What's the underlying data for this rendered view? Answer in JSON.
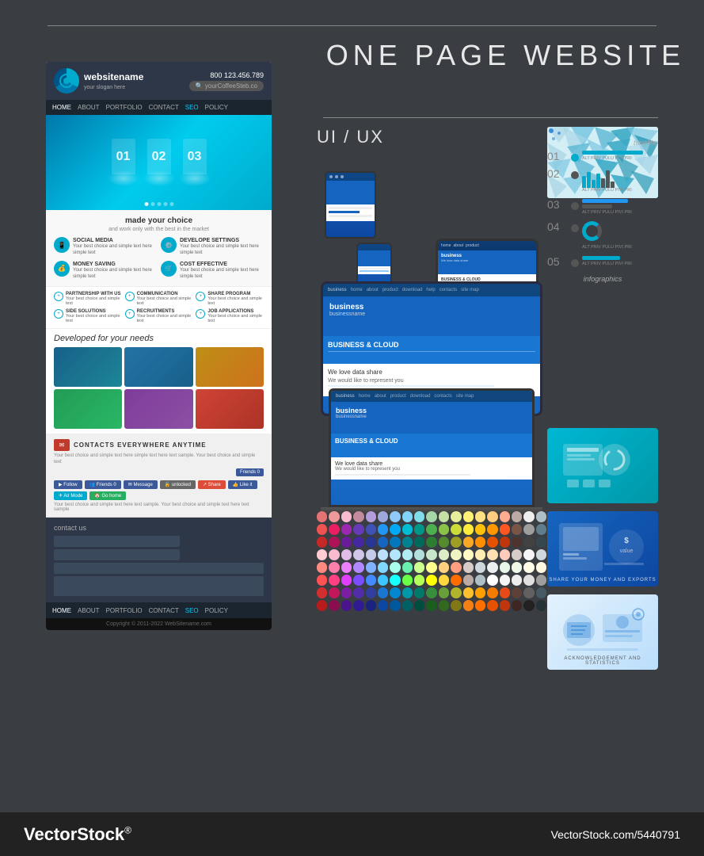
{
  "title": "ONE PAGE WEBSITE",
  "watermark": {
    "left": "VectorStock",
    "registered": "®",
    "right": "VectorStock.com/5440791"
  },
  "website_mockup": {
    "logo_name": "websitename",
    "logo_slogan": "your slogan here",
    "phone": "800 123.456.789",
    "email": "yourCoffeeSteb.co",
    "nav_items": [
      "HOME",
      "ABOUT",
      "PORTFOLIO",
      "CONTACT",
      "SEO",
      "POLICY"
    ],
    "hero_numbers": [
      "01",
      "02",
      "03"
    ],
    "section_title": "made your choice",
    "section_subtitle": "and work only with the best in the market",
    "features": [
      {
        "title": "SOCIAL MEDIA",
        "text": "Your best choice and simple text here simple text here text simple"
      },
      {
        "title": "DEVELOPE SETTINGS",
        "text": "Your best choice and simple text here simple text here text simple"
      },
      {
        "title": "MONEY SAVING",
        "text": "Your best choice and simple text here simple text here text simple"
      },
      {
        "title": "COST EFFECTIVE",
        "text": "Your best choice and simple text here simple text here text simple"
      }
    ],
    "links": [
      {
        "title": "PARTNERSHIP WITH US"
      },
      {
        "title": "COMMUNICATION"
      },
      {
        "title": "SHARE PROGRAM"
      },
      {
        "title": "SIDE SOLUTIONS"
      },
      {
        "title": "RECRUITMENTS"
      },
      {
        "title": "JOB APPLICATIONS"
      }
    ],
    "cards_title": "Developed for your needs",
    "social_title": "CONTACTS EVERYWHERE ANYTIME",
    "social_buttons": [
      "Follow",
      "Friends",
      "Message",
      "unlocked",
      "Share",
      "Like it",
      "Air Mode",
      "Go home"
    ],
    "contact_title": "contact us",
    "copyright": "Copyright © 2011-2022 WebSitename.com"
  },
  "uiux": {
    "title": "UI / UX"
  },
  "timeline": {
    "title": "timeline",
    "items": [
      {
        "number": "01",
        "text": "ALT PRIV PULU PIVI PRI"
      },
      {
        "number": "02",
        "text": "ALT PRIV PULU PIVI PRI"
      },
      {
        "number": "03",
        "text": "ALT PRIV PULU PIVI PRI"
      },
      {
        "number": "04",
        "text": "ALT PRIV PULU PIVI PRI"
      },
      {
        "number": "05",
        "text": "ALT PRIV PULU PIVI PRI"
      }
    ]
  },
  "infographics": {
    "title": "infographics"
  },
  "side_cards": [
    {
      "label": ""
    },
    {
      "label": "SHARE YOUR MONEY AND EXPORTS"
    },
    {
      "label": "ACKNOWLEDGEMENT AND STATISTICS"
    }
  ],
  "color_swatches": {
    "rows": [
      [
        "#e57373",
        "#ef9a9a",
        "#f8bbd0",
        "#c48b9f",
        "#b39ddb",
        "#9fa8da",
        "#90caf9",
        "#81d4fa",
        "#80deea",
        "#a5d6a7",
        "#c5e1a5",
        "#e6ee9c",
        "#fff176",
        "#ffe082",
        "#ffcc80",
        "#ffab91",
        "#bcaaa4",
        "#eeeeee",
        "#b0bec5"
      ],
      [
        "#ef5350",
        "#e91e63",
        "#9c27b0",
        "#673ab7",
        "#3f51b5",
        "#2196f3",
        "#03a9f4",
        "#00bcd4",
        "#009688",
        "#4caf50",
        "#8bc34a",
        "#cddc39",
        "#ffeb3b",
        "#ffc107",
        "#ff9800",
        "#ff5722",
        "#795548",
        "#9e9e9e",
        "#607d8b"
      ],
      [
        "#c62828",
        "#ad1457",
        "#6a1b9a",
        "#4527a0",
        "#283593",
        "#1565c0",
        "#0277bd",
        "#00838f",
        "#00695c",
        "#2e7d32",
        "#558b2f",
        "#9e9d24",
        "#f9a825",
        "#ff8f00",
        "#e65100",
        "#bf360c",
        "#4e342e",
        "#424242",
        "#37474f"
      ],
      [
        "#ffcdd2",
        "#f8bbd0",
        "#e1bee7",
        "#d1c4e9",
        "#c5cae9",
        "#bbdefb",
        "#b3e5fc",
        "#b2ebf2",
        "#b2dfdb",
        "#c8e6c9",
        "#dcedc8",
        "#f0f4c3",
        "#fff9c4",
        "#ffecb3",
        "#ffe0b2",
        "#ffccbc",
        "#d7ccc8",
        "#f5f5f5",
        "#cfd8dc"
      ],
      [
        "#ff8a80",
        "#ff80ab",
        "#ea80fc",
        "#b388ff",
        "#82b1ff",
        "#80d8ff",
        "#a7ffeb",
        "#69f0ae",
        "#ccff90",
        "#ffff8d",
        "#ffd180",
        "#ff9e80",
        "#d7ccc8",
        "#cfd8dc",
        "#eceff1",
        "#e8f5e9",
        "#f1f8e9",
        "#fffde7",
        "#fff8e1"
      ],
      [
        "#ff5252",
        "#ff4081",
        "#e040fb",
        "#7c4dff",
        "#448aff",
        "#40c4ff",
        "#18ffff",
        "#69ff47",
        "#b2ff59",
        "#ffff00",
        "#ffd740",
        "#ff6d00",
        "#bcaaa4",
        "#b0bec5",
        "#ffffff",
        "#f5f5f5",
        "#eeeeee",
        "#e0e0e0",
        "#9e9e9e"
      ],
      [
        "#d32f2f",
        "#c2185b",
        "#7b1fa2",
        "#512da8",
        "#303f9f",
        "#1976d2",
        "#0288d1",
        "#0097a7",
        "#00796b",
        "#388e3c",
        "#689f38",
        "#afb42b",
        "#fbc02d",
        "#ffa000",
        "#f57c00",
        "#e64a19",
        "#5d4037",
        "#616161",
        "#455a64"
      ],
      [
        "#b71c1c",
        "#880e4f",
        "#4a148c",
        "#311b92",
        "#1a237e",
        "#0d47a1",
        "#01579b",
        "#006064",
        "#004d40",
        "#1b5e20",
        "#33691e",
        "#827717",
        "#f57f17",
        "#ff6f00",
        "#e65100",
        "#bf360c",
        "#3e2723",
        "#212121",
        "#263238"
      ]
    ]
  }
}
